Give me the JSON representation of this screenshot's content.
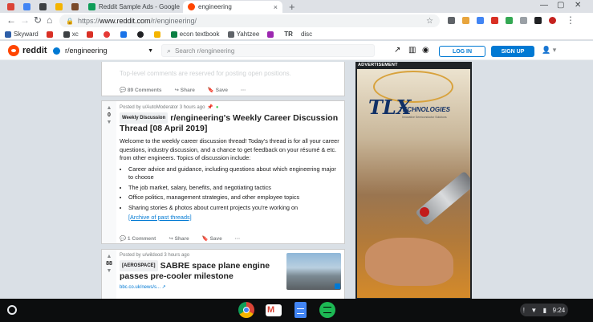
{
  "browser": {
    "tabs": [
      {
        "label": "",
        "active": false,
        "color": "#db4437"
      },
      {
        "label": "",
        "active": false,
        "color": "#4285f4"
      },
      {
        "label": "",
        "active": false,
        "color": "#3c4043"
      },
      {
        "label": "",
        "active": false,
        "color": "#f4b400"
      },
      {
        "label": "",
        "active": false,
        "color": "#7a4a2a"
      },
      {
        "label": "Reddit Sample Ads - Google Drive",
        "active": false,
        "color": "#0f9d58"
      },
      {
        "label": "engineering",
        "active": true,
        "color": "#ff4500"
      }
    ],
    "url_scheme": "https://",
    "url_host": "www.reddit.com",
    "url_path": "/r/engineering/"
  },
  "bookmarks": [
    {
      "label": "Skyward",
      "color": "#2e5fa8"
    },
    {
      "label": "",
      "color": "#d93025"
    },
    {
      "label": "xc",
      "color": "#3c4043"
    },
    {
      "label": "",
      "color": "#d93025"
    },
    {
      "label": "",
      "color": "#e53935"
    },
    {
      "label": "",
      "color": "#1a73e8"
    },
    {
      "label": "",
      "color": "#202124"
    },
    {
      "label": "",
      "color": "#f4b400"
    },
    {
      "label": "econ textbook",
      "color": "#0b8043"
    },
    {
      "label": "Yahtzee",
      "color": "#5f6368"
    },
    {
      "label": "",
      "color": "#9c27b0"
    },
    {
      "label": "TR",
      "color": "#202124"
    },
    {
      "label": "disc",
      "color": "#202124"
    }
  ],
  "reddit": {
    "wordmark": "reddit",
    "subreddit": "r/engineering",
    "search_placeholder": "Search r/engineering",
    "login_label": "LOG IN",
    "signup_label": "SIGN UP"
  },
  "posts": {
    "p0": {
      "faded_text": "Top-level comments are reserved for posting open positions.",
      "comments": "89 Comments",
      "share": "Share",
      "save": "Save"
    },
    "p1": {
      "score": "0",
      "meta": "Posted by u/AutoModerator 3 hours ago",
      "flair": "Weekly Discussion",
      "title": "r/engineering's Weekly Career Discussion Thread [08 April 2019]",
      "intro": "Welcome to the weekly career discussion thread! Today's thread is for all your career questions, industry discussion, and a chance to get feedback on your résumé & etc. from other engineers. Topics of discussion include:",
      "bullets": [
        "Career advice and guidance, including questions about which engineering major to choose",
        "The job market, salary, benefits, and negotiating tactics",
        "Office politics, management strategies, and other employee topics",
        "Sharing stories & photos about current projects you're working on"
      ],
      "link": "[Archive of past threads]",
      "comments": "1 Comment",
      "share": "Share",
      "save": "Save"
    },
    "p2": {
      "score": "88",
      "meta": "Posted by u/wildood 3 hours ago",
      "flair": "[AEROSPACE]",
      "title": "SABRE space plane engine passes pre-cooler milestone",
      "domain": "bbc.co.uk/news/s..."
    }
  },
  "ad": {
    "label": "ADVERTISEMENT",
    "brand": "TLX",
    "brand_sub": "TECHNOLOGIES",
    "tagline": "Innovative Semiconductor Solutions"
  },
  "shelf": {
    "time": "9:24",
    "apps": [
      {
        "name": "chrome",
        "color": "#db4437"
      },
      {
        "name": "gmail",
        "color": "#ffffff"
      },
      {
        "name": "docs",
        "color": "#4285f4"
      },
      {
        "name": "spotify",
        "color": "#1db954"
      }
    ]
  }
}
